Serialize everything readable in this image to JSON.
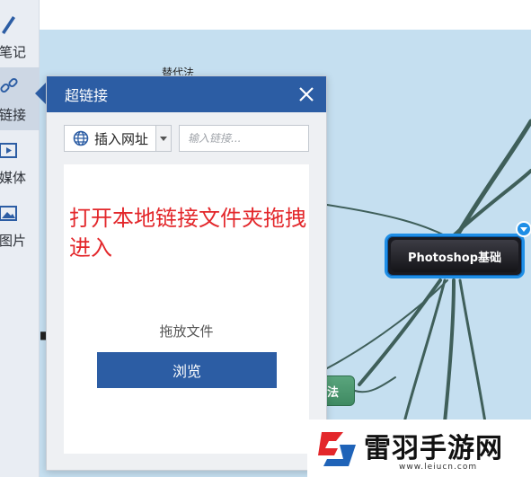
{
  "sidebar": {
    "items": [
      {
        "label": "笔记",
        "icon": "pen-icon"
      },
      {
        "label": "链接",
        "icon": "link-icon",
        "active": true
      },
      {
        "label": "媒体",
        "icon": "film-icon"
      },
      {
        "label": "图片",
        "icon": "image-icon"
      }
    ]
  },
  "mindmap": {
    "central_node": "Photoshop基础",
    "green_node": "法",
    "fragment_top": "替代法"
  },
  "hyperlink_panel": {
    "title": "超链接",
    "insert_select": "插入网址",
    "link_placeholder": "输入链接...",
    "overlay_text": "打开本地链接文件夹拖拽进入",
    "drop_label": "拖放文件",
    "browse_label": "浏览"
  },
  "watermark": {
    "title": "雷羽手游网",
    "url": "www.leiucn.com"
  },
  "colors": {
    "accent": "#2c5da4",
    "canvas": "#c5dff0",
    "overlay_red": "#e3272b",
    "node_border": "#1e8ee6",
    "branch": "#3f5f5a"
  }
}
